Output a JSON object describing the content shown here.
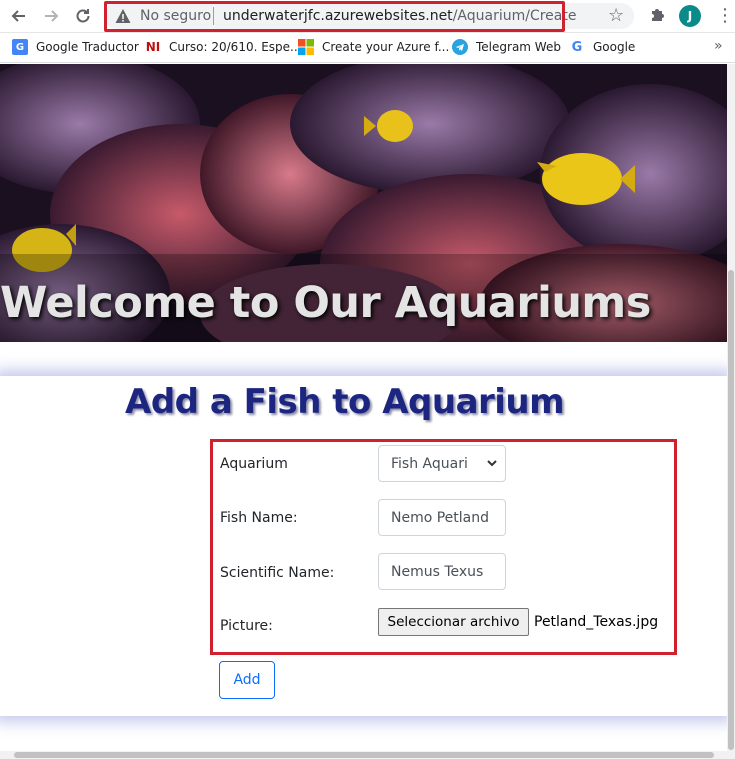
{
  "browser": {
    "security_label": "No seguro",
    "url_host": "underwaterjfc.azurewebsites.net",
    "url_path": "/Aquarium/Create",
    "profile_initial": "J"
  },
  "bookmarks": [
    {
      "label": "Google Traductor",
      "icon": "google-translate-icon"
    },
    {
      "label": "Curso: 20/610. Espe...",
      "icon": "ni-logo-icon"
    },
    {
      "label": "Create your Azure f...",
      "icon": "microsoft-logo-icon"
    },
    {
      "label": "Telegram Web",
      "icon": "telegram-icon"
    },
    {
      "label": "Google",
      "icon": "google-icon"
    }
  ],
  "banner": {
    "title": "Welcome to Our Aquariums"
  },
  "form": {
    "heading": "Add a Fish to Aquarium",
    "aquarium_label": "Aquarium",
    "aquarium_value": "Fish Aquari",
    "fish_name_label": "Fish Name:",
    "fish_name_value": "Nemo Petland",
    "scientific_name_label": "Scientific Name:",
    "scientific_name_value": "Nemus Texus",
    "picture_label": "Picture:",
    "file_button_label": "Seleccionar archivo",
    "file_name": "Petland_Texas.jpg",
    "submit_label": "Add"
  },
  "colors": {
    "highlight": "#d0212e",
    "heading": "#1c2580",
    "primary": "#0d6efd"
  }
}
